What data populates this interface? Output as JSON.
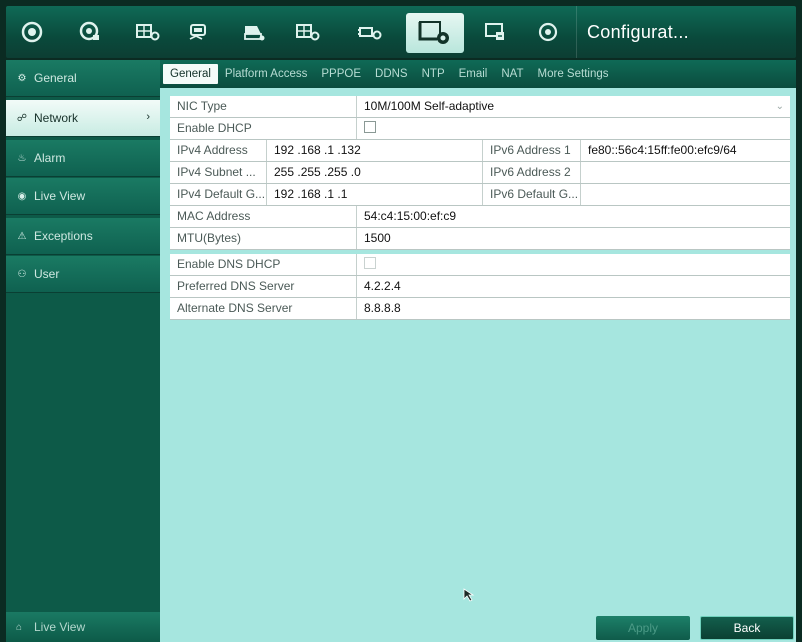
{
  "toolbar": {
    "icons": [
      "play-circle-icon",
      "playback-icon",
      "camera-settings-icon",
      "record-icon",
      "hdd-icon",
      "camera-settings-icon",
      "network-icon",
      "configuration-icon",
      "maintenance-icon",
      "shutdown-icon"
    ],
    "title": "Configurat..."
  },
  "sidebar": {
    "items": [
      {
        "label": "General",
        "icon": "gear-icon"
      },
      {
        "label": "Network",
        "icon": "network-icon"
      },
      {
        "label": "Alarm",
        "icon": "alarm-icon"
      },
      {
        "label": "Live View",
        "icon": "eye-icon"
      },
      {
        "label": "Exceptions",
        "icon": "warning-icon"
      },
      {
        "label": "User",
        "icon": "user-icon"
      }
    ],
    "bottom_label": "Live View"
  },
  "tabs": [
    "General",
    "Platform Access",
    "PPPOE",
    "DDNS",
    "NTP",
    "Email",
    "NAT",
    "More Settings"
  ],
  "form": {
    "nic_type_label": "NIC Type",
    "nic_type_value": "10M/100M Self-adaptive",
    "enable_dhcp_label": "Enable DHCP",
    "ipv4_address_label": "IPv4 Address",
    "ipv4_address_value": "192 .168 .1    .132",
    "ipv6_address1_label": "IPv6 Address 1",
    "ipv6_address1_value": "fe80::56c4:15ff:fe00:efc9/64",
    "ipv4_subnet_label": "IPv4 Subnet ...",
    "ipv4_subnet_value": "255 .255 .255 .0",
    "ipv6_address2_label": "IPv6 Address 2",
    "ipv6_address2_value": "",
    "ipv4_gateway_label": "IPv4 Default G...",
    "ipv4_gateway_value": "192 .168 .1    .1",
    "ipv6_gateway_label": "IPv6 Default G...",
    "ipv6_gateway_value": "",
    "mac_label": "MAC Address",
    "mac_value": "54:c4:15:00:ef:c9",
    "mtu_label": "MTU(Bytes)",
    "mtu_value": "1500",
    "enable_dns_dhcp_label": "Enable DNS DHCP",
    "preferred_dns_label": "Preferred DNS Server",
    "preferred_dns_value": "4.2.2.4",
    "alternate_dns_label": "Alternate DNS Server",
    "alternate_dns_value": "8.8.8.8"
  },
  "buttons": {
    "apply": "Apply",
    "back": "Back"
  },
  "colors": {
    "accent": "#0f6a56",
    "panel": "#a6e6df"
  }
}
